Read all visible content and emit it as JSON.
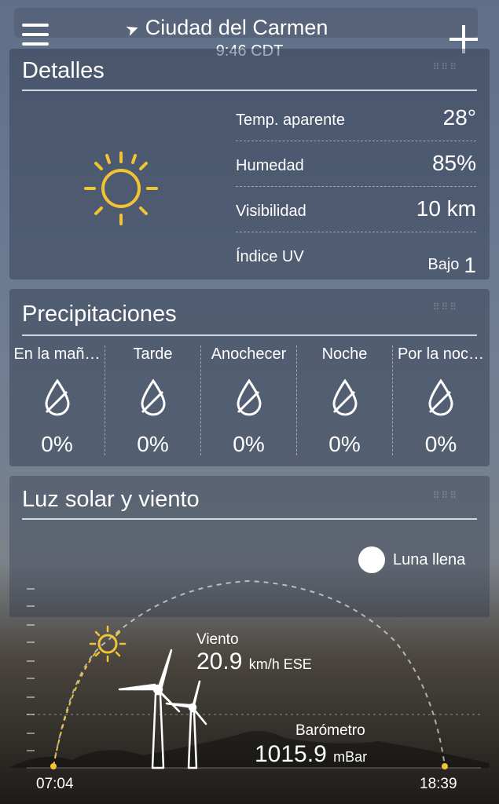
{
  "header": {
    "city": "Ciudad del Carmen",
    "time": "9:46 CDT",
    "menu_icon": "menu-icon",
    "add_icon": "plus-icon",
    "location_icon": "location-arrow-icon"
  },
  "details": {
    "title": "Detalles",
    "condition_icon": "sun-icon",
    "rows": [
      {
        "label": "Temp. aparente",
        "value": "28°"
      },
      {
        "label": "Humedad",
        "value": "85%"
      },
      {
        "label": "Visibilidad",
        "value": "10 km"
      },
      {
        "label": "Índice UV",
        "value": "Bajo",
        "value_number": "1"
      }
    ]
  },
  "precipitation": {
    "title": "Precipitaciones",
    "periods": [
      {
        "label": "En la mañ…",
        "value": "0%"
      },
      {
        "label": "Tarde",
        "value": "0%"
      },
      {
        "label": "Anochecer",
        "value": "0%"
      },
      {
        "label": "Noche",
        "value": "0%"
      },
      {
        "label": "Por la noc…",
        "value": "0%"
      }
    ]
  },
  "sun_wind": {
    "title": "Luz solar y viento",
    "moon_label": "Luna llena",
    "wind_label": "Viento",
    "wind_speed": "20.9",
    "wind_unit": "km/h ESE",
    "barometer_label": "Barómetro",
    "barometer_value": "1015.9",
    "barometer_unit": "mBar",
    "sunrise": "07:04",
    "sunset": "18:39"
  },
  "colors": {
    "sun": "#f2c434",
    "text": "#ffffff"
  }
}
